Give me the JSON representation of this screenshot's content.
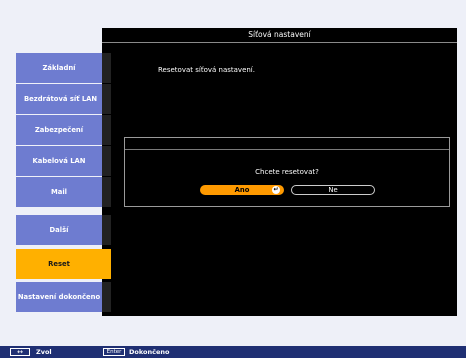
{
  "window": {
    "title": "Síťová nastavení"
  },
  "main": {
    "message": "Resetovat síťová nastavení."
  },
  "menu": {
    "items": [
      {
        "label": "Základní",
        "selected": false
      },
      {
        "label": "Bezdrátová síť LAN",
        "selected": false
      },
      {
        "label": "Zabezpečení",
        "selected": false
      },
      {
        "label": "Kabelová LAN",
        "selected": false
      },
      {
        "label": "Mail",
        "selected": false
      },
      {
        "label": "Další",
        "selected": false
      },
      {
        "label": "Reset",
        "selected": true
      },
      {
        "label": "Nastavení dokončeno",
        "selected": false
      }
    ]
  },
  "dialog": {
    "question": "Chcete resetovat?",
    "yes_label": "Ano",
    "no_label": "Ne"
  },
  "help": {
    "nav_key": "↔",
    "nav_label": "Zvol",
    "enter_key": "Enter",
    "enter_label": "Dokončeno"
  },
  "colors": {
    "menu_item": "#6e7cd0",
    "menu_selected": "#ffb000",
    "yes_button": "#ff9a00",
    "help_bar": "#1f2f73"
  }
}
